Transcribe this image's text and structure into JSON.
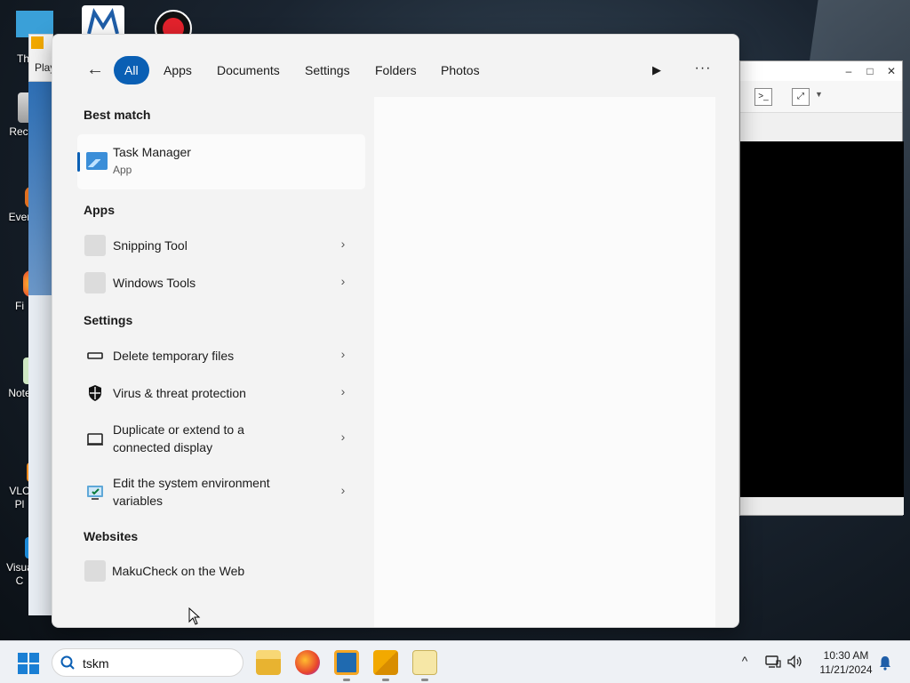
{
  "colors": {
    "accent": "#0a5fb4",
    "panel_bg": "#f3f3f3",
    "taskbar_bg": "#eef1f5"
  },
  "desktop": {
    "icons": [
      {
        "label": "Th",
        "icon": "folder-icon"
      },
      {
        "label": "Recy",
        "icon": "recycle-bin-icon"
      },
      {
        "label": "Ever",
        "icon": "app-shortcut-icon"
      },
      {
        "label": "Fi",
        "icon": "firefox-icon"
      },
      {
        "label": "Note",
        "icon": "notepad-icon"
      },
      {
        "label": "VLC\nPl",
        "icon": "vlc-icon"
      },
      {
        "label": "Visua\nC",
        "icon": "vscode-icon"
      }
    ],
    "partial_window_label": "Play"
  },
  "filters": {
    "back": "←",
    "tabs": [
      "All",
      "Apps",
      "Documents",
      "Settings",
      "Folders",
      "Photos"
    ],
    "active": "All",
    "play": "▶",
    "more": "···"
  },
  "best_match": {
    "heading": "Best match",
    "name": "Task Manager",
    "kind": "App"
  },
  "apps": {
    "heading": "Apps",
    "items": [
      {
        "label": "Snipping Tool"
      },
      {
        "label": "Windows Tools"
      }
    ]
  },
  "settings": {
    "heading": "Settings",
    "items": [
      {
        "label": "Delete temporary files",
        "icon": "storage-icon"
      },
      {
        "label": "Virus & threat protection",
        "icon": "shield-icon"
      },
      {
        "label_line1": "Duplicate or extend to a",
        "label_line2": "connected display",
        "icon": "monitor-icon"
      },
      {
        "label_line1": "Edit the system environment",
        "label_line2": "variables",
        "icon": "system-properties-icon"
      }
    ]
  },
  "websites": {
    "heading": "Websites",
    "items": [
      {
        "label": "MakuCheck on the Web"
      }
    ]
  },
  "chevron": "›",
  "taskbar": {
    "search_value": "tskm",
    "apps": [
      "file-explorer-icon",
      "firefox-icon",
      "virtualbox-icon",
      "vmware-icon",
      "notepad-icon"
    ],
    "tray": {
      "chevron": "^"
    },
    "time": "10:30 AM",
    "date": "11/21/2024"
  }
}
